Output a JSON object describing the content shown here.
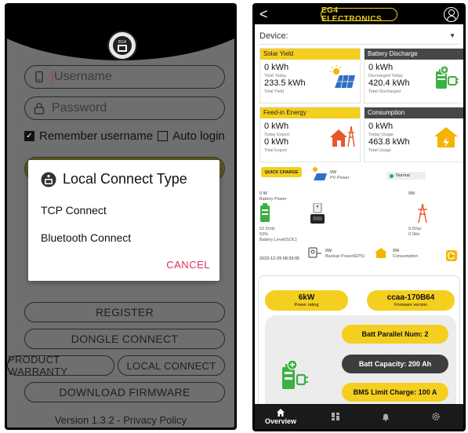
{
  "left": {
    "username_placeholder": "Username",
    "password_placeholder": "Password",
    "remember_label": "Remember username",
    "auto_login_label": "Auto login",
    "buttons": {
      "register": "REGISTER",
      "dongle": "DONGLE CONNECT",
      "warranty": "PRODUCT WARRANTY",
      "local": "LOCAL CONNECT",
      "firmware": "DOWNLOAD FIRMWARE"
    },
    "version": "Version 1.3.2 - Privacy Policy",
    "logo_text": "EG4",
    "modal": {
      "title": "Local Connect Type",
      "option1": "TCP Connect",
      "option2": "Bluetooth Connect",
      "cancel": "CANCEL"
    }
  },
  "right": {
    "header": {
      "back": "<",
      "brand": "EG4 ELECTRONICS"
    },
    "device_label": "Device:",
    "cards": {
      "solar": {
        "title": "Solar Yield",
        "v1": "0 kWh",
        "l1": "Yield Today",
        "v2": "233.5 kWh",
        "l2": "Total Yield"
      },
      "discharge": {
        "title": "Battery Discharge",
        "v1": "0 kWh",
        "l1": "Discharged Today",
        "v2": "420.4 kWh",
        "l2": "Total Discharged"
      },
      "feedin": {
        "title": "Feed-in Energy",
        "v1": "0 kWh",
        "l1": "Today Export",
        "v2": "0 kWh",
        "l2": "Total Export"
      },
      "consumption": {
        "title": "Consumption",
        "v1": "0 kWh",
        "l1": "Today Usage",
        "v2": "463.8 kWh",
        "l2": "Total Usage"
      }
    },
    "flow": {
      "quick_charge": "QUICK CHARGE",
      "pv_value": "0W",
      "pv_label": "PV Power",
      "status": "Normal",
      "battery_power_value": "0 W",
      "battery_power_label": "Battery Power",
      "grid_power_value": "0W",
      "battery_voltage": "52.5Vdc",
      "battery_soc": "53%",
      "battery_soc_label": "Battery Level(SOC)",
      "grid_voltage": "0.0Vac",
      "grid_freq": "0.0Hz",
      "timestamp": "2023-12-29 08:39:05",
      "eps_value": "0W",
      "eps_label": "Backup Power(EPS)",
      "consumption_value": "0W",
      "consumption_label": "Consumption"
    },
    "info": {
      "rating_value": "6kW",
      "rating_label": "Power rating",
      "firmware_value": "ccaa-170B64",
      "firmware_label": "Firmware version",
      "parallel": "Batt Parallel Num: 2",
      "capacity": "Batt Capacity: 200 Ah",
      "bms": "BMS Limit Charge: 100 A"
    },
    "tabs": {
      "overview": "Overview"
    }
  },
  "colors": {
    "accent": "#f4cf1f",
    "dark": "#474747",
    "cancel": "#d8335b",
    "status_ok": "#22b14c"
  }
}
